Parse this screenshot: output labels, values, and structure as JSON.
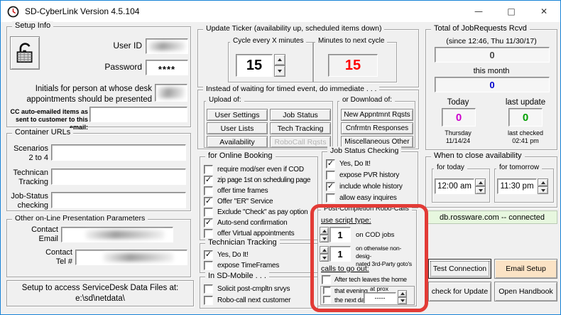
{
  "window": {
    "title": "SD-CyberLink Version 4.5.104",
    "controls": {
      "minimize": "—",
      "maximize": "□",
      "close": "✕"
    }
  },
  "setup_info": {
    "title": "Setup Info",
    "user_id": {
      "label": "User ID",
      "value": ""
    },
    "password": {
      "label": "Password",
      "value": "****"
    },
    "initials_label": "Initials for person at whose desk\nappointments should be presented",
    "initials_value": "",
    "cc_label": "CC auto-emailed items as\nsent to customer to this email:",
    "cc_value": ""
  },
  "container_urls": {
    "title": "Container URLs",
    "rows": [
      {
        "label": "Scenarios\n2 to 4",
        "value": ""
      },
      {
        "label": "Technican\nTracking",
        "value": ""
      },
      {
        "label": "Job-Status\nchecking",
        "value": ""
      }
    ]
  },
  "presentation_params": {
    "title": "Other on-Line Presentation Parameters",
    "contact_email_label": "Contact\nEmail",
    "contact_email_value": "",
    "contact_tel_label": "Contact\nTel #",
    "contact_tel_value": ""
  },
  "data_files_note": "Setup to access ServiceDesk Data Files at:\ne:\\sd\\netdata\\",
  "update_ticker": {
    "title": "Update Ticker (availability up, scheduled items down)",
    "cycle": {
      "label": "Cycle every X minutes",
      "value": "15"
    },
    "next": {
      "label": "Minutes to next cycle",
      "value": "15",
      "color": "#ff0000"
    }
  },
  "immediate": {
    "title": "Instead of waiting for timed event, do immediate . . .",
    "upload": {
      "title": "Upload of:",
      "buttons": [
        {
          "label": "User Settings",
          "enabled": true
        },
        {
          "label": "Job Status",
          "enabled": true
        },
        {
          "label": "User Lists",
          "enabled": true
        },
        {
          "label": "Tech Tracking",
          "enabled": true
        },
        {
          "label": "Availability",
          "enabled": true
        },
        {
          "label": "RoboCall Rqsts",
          "enabled": false
        }
      ]
    },
    "download": {
      "title": "or Download of:",
      "buttons": [
        "New Appntmnt Rqsts",
        "Cnfrmtn Responses",
        "Miscellaneous Other"
      ]
    }
  },
  "online_booking": {
    "title": "for Online Booking",
    "items": [
      {
        "label": "require mod/ser even if COD",
        "check": ""
      },
      {
        "label": "zip page 1st on scheduling page",
        "check": "✓"
      },
      {
        "label": "offer time frames",
        "check": ""
      },
      {
        "label": "Offer \"ER\" Service",
        "check": "✓"
      },
      {
        "label": "Exclude \"Check\" as pay option",
        "check": ""
      },
      {
        "label": "Auto-send confirmation",
        "check": "✓"
      },
      {
        "label": "offer Virtual appointments",
        "check": ""
      }
    ]
  },
  "technician_tracking": {
    "title": "Technician Tracking",
    "items": [
      {
        "label": "Yes, Do It!",
        "check": "✓"
      },
      {
        "label": "expose TimeFrames",
        "check": ""
      }
    ]
  },
  "sd_mobile": {
    "title": "In SD-Mobile . . .",
    "items": [
      {
        "label": "Solicit post-cmpltn srvys",
        "check": ""
      },
      {
        "label": "Robo-call next customer",
        "check": ""
      }
    ]
  },
  "job_status_checking": {
    "title": "Job Status Checking",
    "items": [
      {
        "label": "Yes, Do It!",
        "check": "✓"
      },
      {
        "label": "expose PVR history",
        "check": ""
      },
      {
        "label": "include whole history",
        "check": "✓"
      },
      {
        "label": "allow easy inquires",
        "check": ""
      }
    ]
  },
  "robo_calls": {
    "title": "Post-Completion Robo-Calls",
    "script_heading": "use script type:",
    "script_rows": [
      {
        "value": "1",
        "label": "on COD jobs"
      },
      {
        "value": "1",
        "label": "on otherwise non-desig-\nnated 3rd-Party goto's"
      }
    ],
    "calls_heading": "calls to go out:",
    "after_tech": {
      "label": "After tech leaves the home",
      "check": ""
    },
    "evening": {
      "label": "that evening",
      "check": ""
    },
    "next_day": {
      "label": "the next day",
      "check": ""
    },
    "at_prox_label": "at prox",
    "at_prox_value": "-----",
    "highlight_color": "#e23b36"
  },
  "job_requests": {
    "title": "Total of JobRequests Rcvd",
    "since_label": "(since 12:46, Thu 11/30/17)",
    "since_value": "0",
    "month_label": "this month",
    "month_value": "0",
    "today_label": "Today",
    "today_value": "0",
    "today_date": "Thursday\n11/14/24",
    "last_update_label": "last update",
    "last_update_value": "0",
    "last_checked": "last checked\n02:41 pm",
    "colors": {
      "since": "#484848",
      "month": "#0000cc",
      "today": "#cc00cc",
      "last_update": "#00a000"
    }
  },
  "close_availability": {
    "title": "When to close availability",
    "today": {
      "label": "for today",
      "value": "12:00 am"
    },
    "tomorrow": {
      "label": "for tomorrow",
      "value": "11:30 pm"
    }
  },
  "connection_status": {
    "text": "db.rossware.com -- connected",
    "bg": "#e7f7df"
  },
  "action_buttons": {
    "test_connection": "Test Connection",
    "email_setup": "Email Setup",
    "email_setup_bg": "#fbe3c5",
    "check_update": "check for Update",
    "open_handbook": "Open Handbook"
  }
}
